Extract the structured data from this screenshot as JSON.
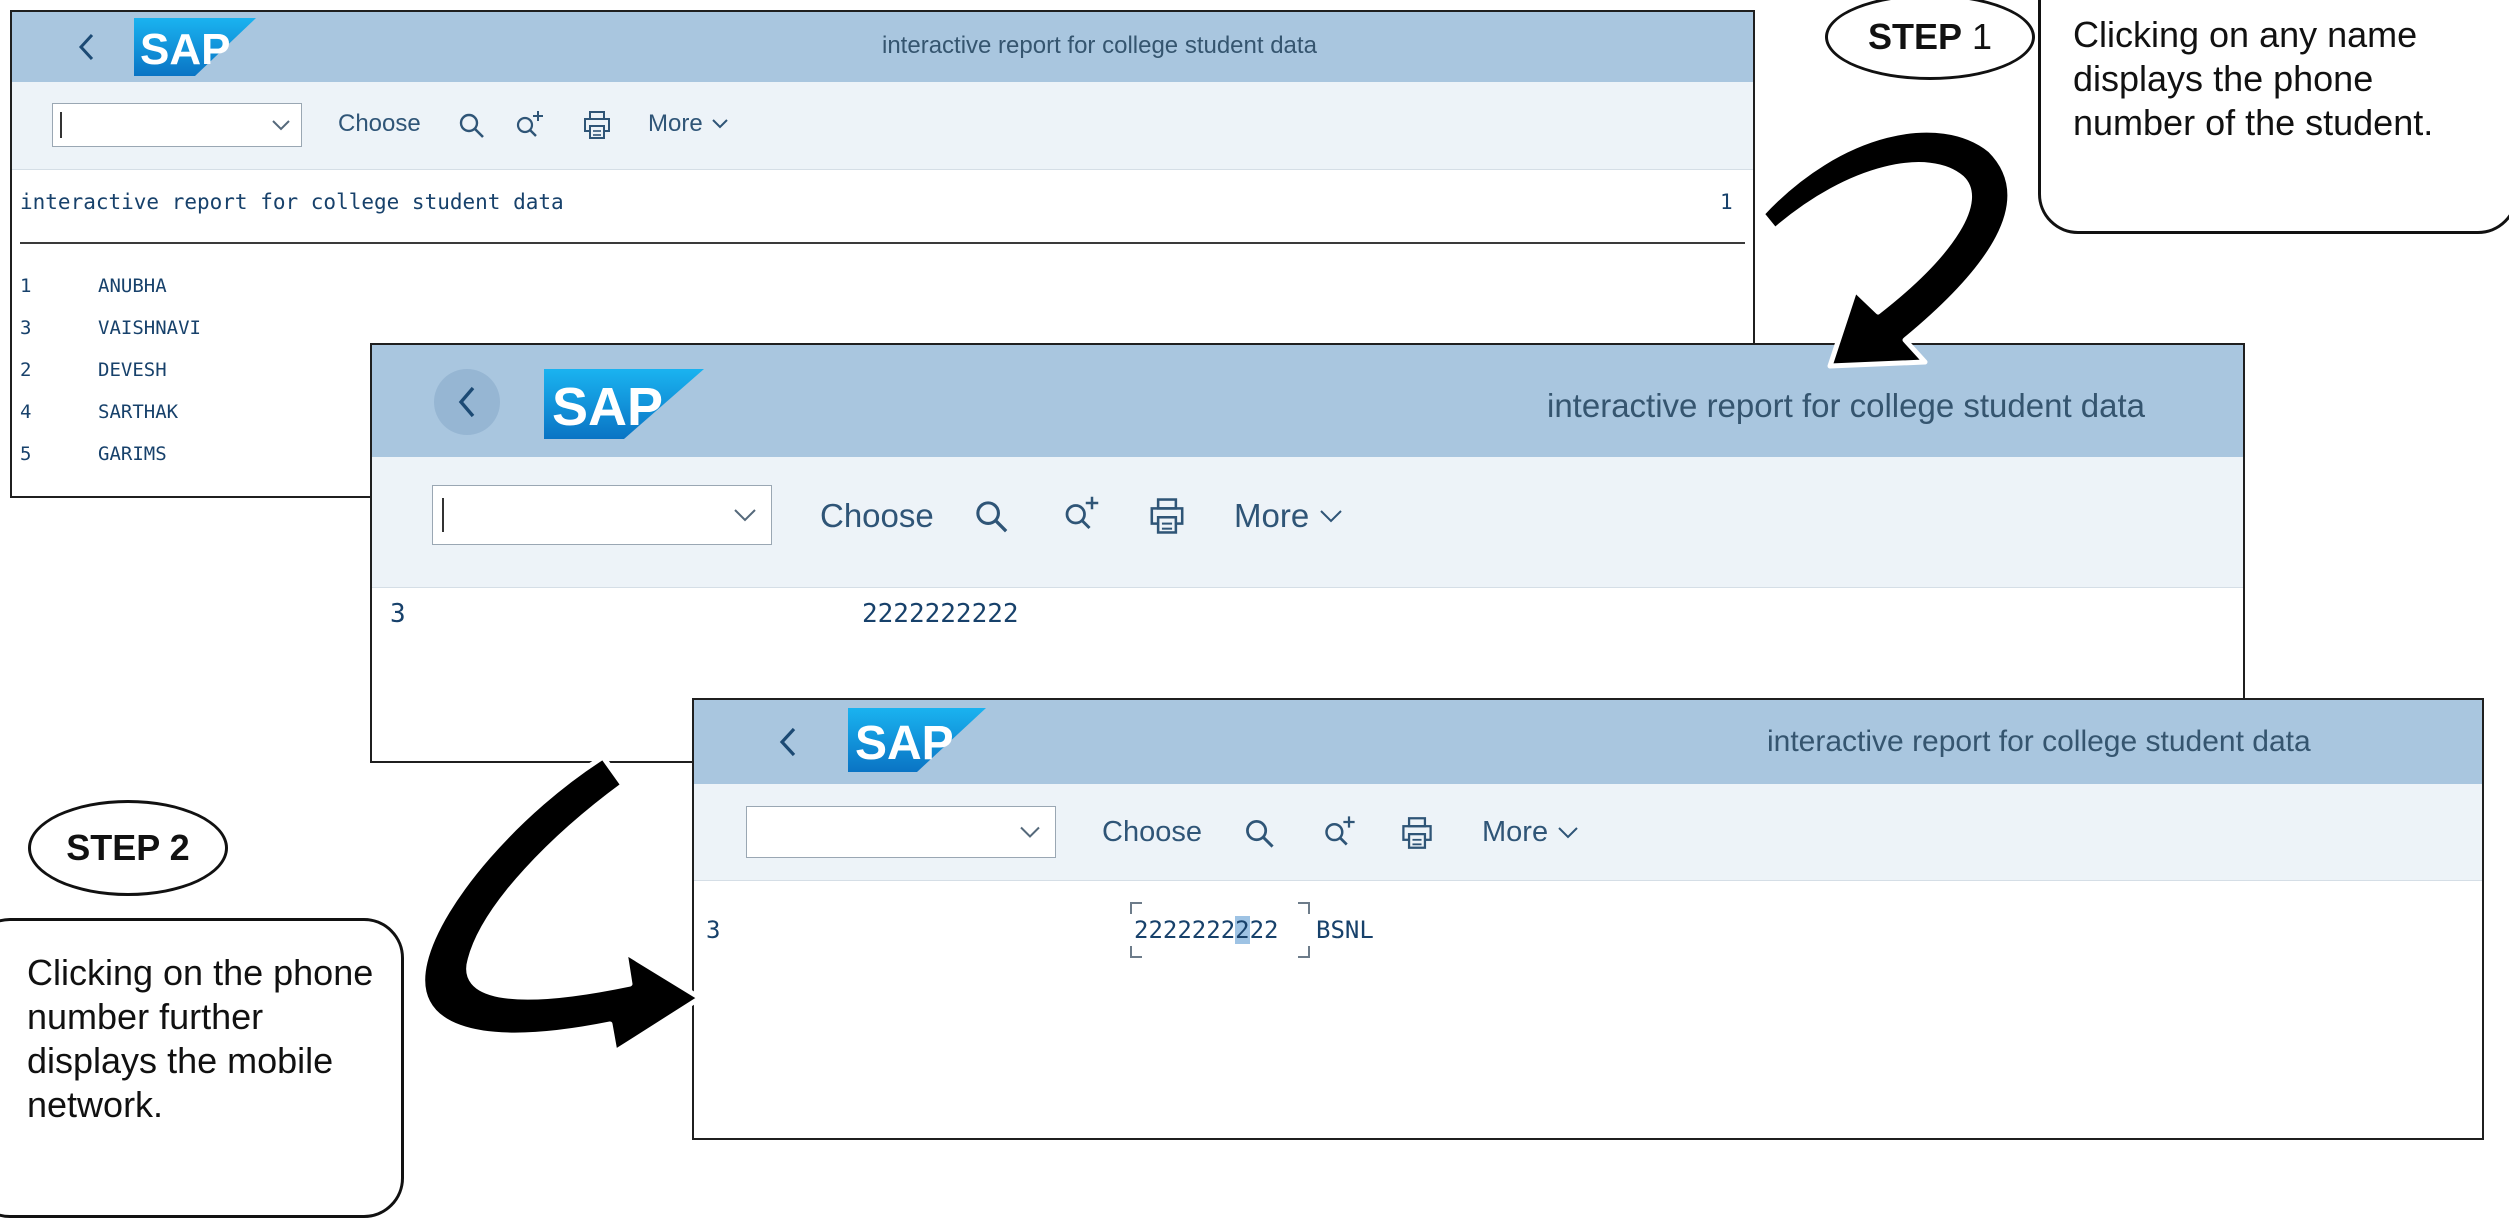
{
  "report_title": "interactive report for college student data",
  "logo_text": "SAP",
  "toolbar": {
    "choose": "Choose",
    "more": "More"
  },
  "icons": {
    "back": "chevron-left-icon",
    "search": "search-icon",
    "find_next": "find-next-icon",
    "print": "print-icon",
    "more_chevron": "chevron-down-icon",
    "dropdown_chevron": "chevron-down-icon"
  },
  "screen1": {
    "list_header": "interactive report for college student data",
    "page_no": "1",
    "rows": [
      {
        "id": "1",
        "name": "ANUBHA"
      },
      {
        "id": "3",
        "name": "VAISHNAVI"
      },
      {
        "id": "2",
        "name": "DEVESH"
      },
      {
        "id": "4",
        "name": "SARTHAK"
      },
      {
        "id": "5",
        "name": "GARIMS"
      }
    ]
  },
  "screen2": {
    "row": {
      "id": "3",
      "phone": "2222222222"
    }
  },
  "screen3": {
    "row": {
      "id": "3",
      "phone_start": "2222222",
      "phone_cursor": "2",
      "phone_end": "22",
      "network": "BSNL"
    }
  },
  "callouts": {
    "step1_bold": "STEP",
    "step1_num": "1",
    "step1_text": "Clicking on any name displays the phone number of the student.",
    "step2_label": "STEP 2",
    "step2_text": "Clicking on the phone number further displays the mobile network."
  },
  "colors": {
    "header_bg": "#a9c6df",
    "toolbar_bg": "#edf3f8",
    "sap_blue": "#149ae0",
    "text_blue": "#17416b"
  }
}
